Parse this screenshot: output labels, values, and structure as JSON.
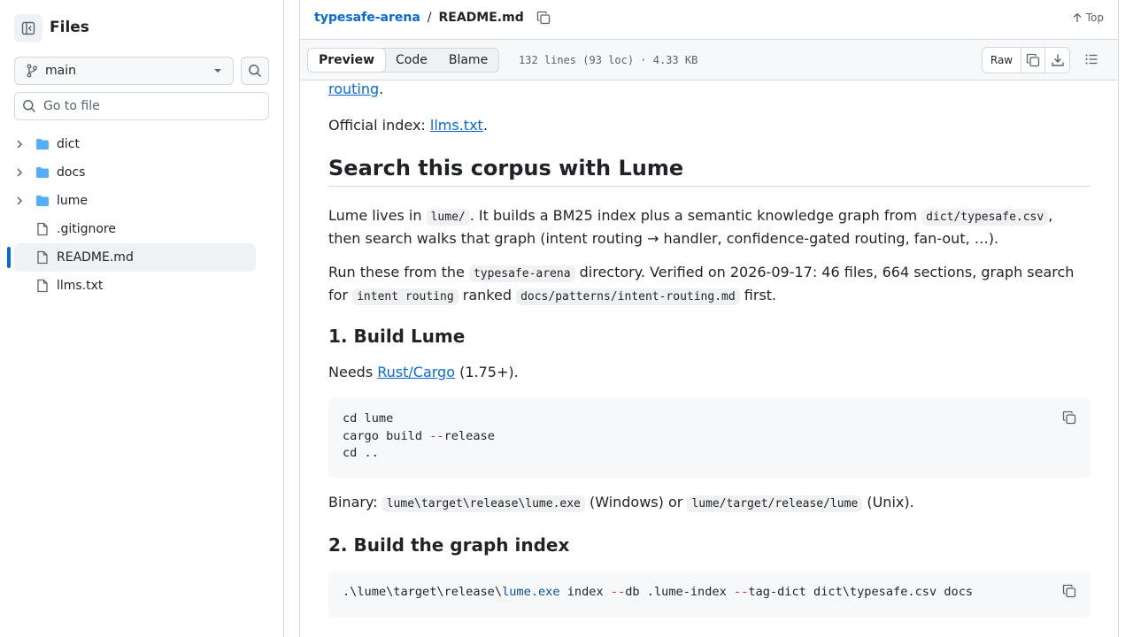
{
  "sidebar": {
    "title": "Files",
    "branch": "main",
    "goto_placeholder": "Go to file",
    "items": [
      {
        "label": "dict",
        "type": "folder"
      },
      {
        "label": "docs",
        "type": "folder"
      },
      {
        "label": "lume",
        "type": "folder"
      },
      {
        "label": ".gitignore",
        "type": "file"
      },
      {
        "label": "README.md",
        "type": "file",
        "active": true
      },
      {
        "label": "llms.txt",
        "type": "file"
      }
    ]
  },
  "header": {
    "repo": "typesafe-arena",
    "separator": "/",
    "file": "README.md",
    "top_label": "Top"
  },
  "toolbar": {
    "tabs": [
      "Preview",
      "Code",
      "Blame"
    ],
    "active_tab": "Preview",
    "file_info": "132 lines (93 loc) · 4.33 KB",
    "raw_label": "Raw"
  },
  "content": {
    "routing_link": "routing",
    "routing_tail": ".",
    "official_prefix": "Official index: ",
    "official_link": "llms.txt",
    "official_tail": ".",
    "h2": "Search this corpus with Lume",
    "p1_a": "Lume lives in ",
    "p1_code1": "lume/",
    "p1_b": ". It builds a BM25 index plus a semantic knowledge graph from ",
    "p1_code2": "dict/typesafe.csv",
    "p1_c": ",",
    "p1_line2": "then search walks that graph (intent routing → handler, confidence-gated routing, fan-out, …).",
    "p2_a": "Run these from the ",
    "p2_code1": "typesafe-arena",
    "p2_b": " directory. Verified on 2026-09-17: 46 files, 664 sections, graph search",
    "p2_c": "for ",
    "p2_code2": "intent routing",
    "p2_d": " ranked ",
    "p2_code3": "docs/patterns/intent-routing.md",
    "p2_e": " first.",
    "h3_1": "1. Build Lume",
    "needs_a": "Needs ",
    "needs_link": "Rust/Cargo",
    "needs_b": " (1.75+).",
    "code1_line1": "cd lume",
    "code1_line2a": "cargo build ",
    "code1_line2b": "--",
    "code1_line2c": "release",
    "code1_line3": "cd ..",
    "bin_a": "Binary: ",
    "bin_code1": "lume\\target\\release\\lume.exe",
    "bin_b": " (Windows) or ",
    "bin_code2": "lume/target/release/lume",
    "bin_c": " (Unix).",
    "h3_2": "2. Build the graph index",
    "code2_a": ".\\lume\\target\\release\\",
    "code2_b": "lume.exe",
    "code2_c": " index ",
    "code2_d": "--",
    "code2_e": "db .lume-index ",
    "code2_f": "--",
    "code2_g": "tag-dict dict\\typesafe.csv docs"
  }
}
